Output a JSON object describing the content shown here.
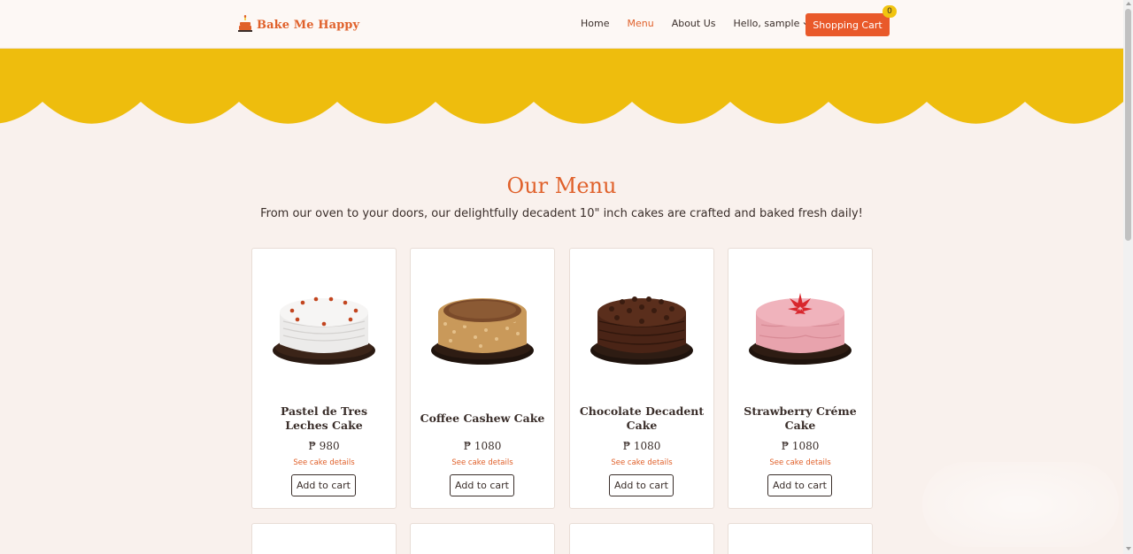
{
  "brand": {
    "name": "Bake Me Happy",
    "icon": "cake-logo-icon"
  },
  "nav": {
    "home": "Home",
    "menu": "Menu",
    "about": "About Us",
    "user": "Hello, sample",
    "cart_label": "Shopping Cart",
    "cart_count": "0"
  },
  "colors": {
    "accent": "#e0612b",
    "scallop": "#eebd0d",
    "background": "#f9f1ed",
    "badge": "#f1c40f"
  },
  "heading": {
    "title": "Our Menu",
    "subtitle": "From our oven to your doors, our delightfully decadent 10\" inch cakes are crafted and baked fresh daily!"
  },
  "products": [
    {
      "name": "Pastel de Tres Leches Cake",
      "price": "₱ 980",
      "details_link": "See cake details",
      "button": "Add to cart",
      "image": "white-cake-image"
    },
    {
      "name": "Coffee Cashew Cake",
      "price": "₱ 1080",
      "details_link": "See cake details",
      "button": "Add to cart",
      "image": "cashew-cake-image"
    },
    {
      "name": "Chocolate Decadent Cake",
      "price": "₱ 1080",
      "details_link": "See cake details",
      "button": "Add to cart",
      "image": "chocolate-cake-image"
    },
    {
      "name": "Strawberry Créme Cake",
      "price": "₱ 1080",
      "details_link": "See cake details",
      "button": "Add to cart",
      "image": "strawberry-cake-image"
    }
  ]
}
